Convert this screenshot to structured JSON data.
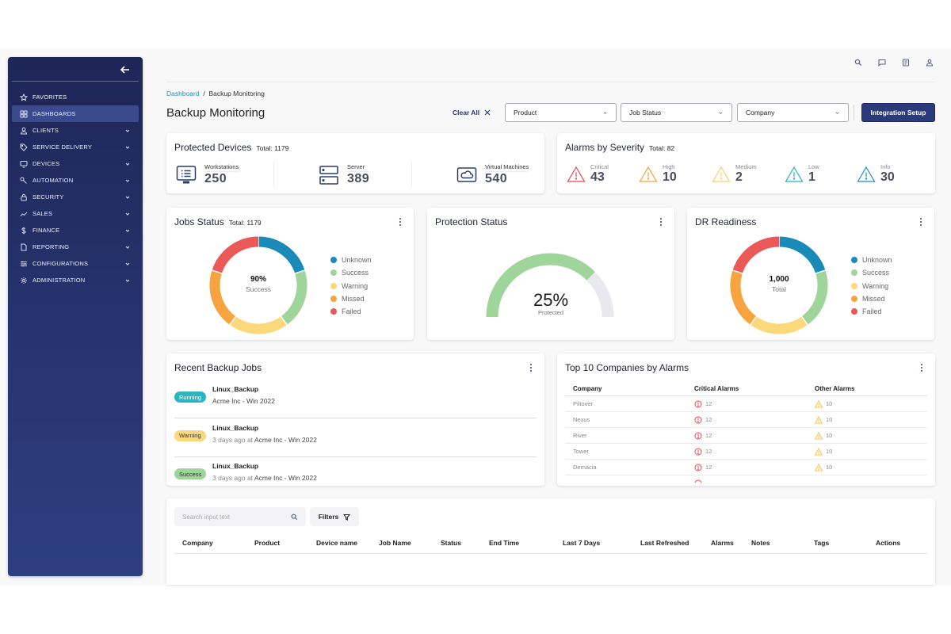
{
  "sidebar": {
    "items": [
      {
        "label": "FAVORITES",
        "icon": "star-icon",
        "chevron": false,
        "active": false
      },
      {
        "label": "DASHBOARDS",
        "icon": "dashboard-grid-icon",
        "chevron": false,
        "active": true
      },
      {
        "label": "CLIENTS",
        "icon": "user-icon",
        "chevron": true,
        "active": false
      },
      {
        "label": "SERVICE DELIVERY",
        "icon": "tag-icon",
        "chevron": true,
        "active": false
      },
      {
        "label": "DEVICES",
        "icon": "monitor-icon",
        "chevron": true,
        "active": false
      },
      {
        "label": "AUTOMATION",
        "icon": "wrench-icon",
        "chevron": true,
        "active": false
      },
      {
        "label": "SECURITY",
        "icon": "lock-icon",
        "chevron": true,
        "active": false
      },
      {
        "label": "SALES",
        "icon": "trend-icon",
        "chevron": true,
        "active": false
      },
      {
        "label": "FINANCE",
        "icon": "dollar-icon",
        "chevron": true,
        "active": false
      },
      {
        "label": "REPORTING",
        "icon": "document-icon",
        "chevron": true,
        "active": false
      },
      {
        "label": "CONFIGURATIONS",
        "icon": "sliders-icon",
        "chevron": true,
        "active": false
      },
      {
        "label": "ADMINISTRATION",
        "icon": "gear-icon",
        "chevron": true,
        "active": false
      }
    ]
  },
  "header": {
    "breadcrumb": {
      "root": "Dashboard",
      "separator": "/",
      "current": "Backup Monitoring"
    },
    "title": "Backup Monitoring",
    "clear_all": "Clear All",
    "filters": [
      {
        "label": "Product"
      },
      {
        "label": "Job Status"
      },
      {
        "label": "Company"
      }
    ],
    "primary_button": "Integration Setup",
    "top_icons": [
      "search-icon",
      "chat-icon",
      "notes-icon",
      "user-icon"
    ]
  },
  "protected_devices": {
    "title": "Protected Devices",
    "total_label": "Total: 1179",
    "items": [
      {
        "label": "Workstations",
        "value": "250",
        "icon": "workstation-icon"
      },
      {
        "label": "Server",
        "value": "389",
        "icon": "server-icon"
      },
      {
        "label": "Virtual Machines",
        "value": "540",
        "icon": "cloud-vm-icon"
      }
    ]
  },
  "alarms": {
    "title": "Alarms by Severity",
    "total_label": "Total: 82",
    "items": [
      {
        "label": "Critical",
        "value": "43",
        "color": "#e5484d"
      },
      {
        "label": "High",
        "value": "10",
        "color": "#f0a03a"
      },
      {
        "label": "Medium",
        "value": "2",
        "color": "#f5cf6a"
      },
      {
        "label": "Low",
        "value": "1",
        "color": "#24b3c0"
      },
      {
        "label": "Info",
        "value": "30",
        "color": "#1f8db5"
      }
    ]
  },
  "jobs_status": {
    "title": "Jobs Status",
    "total_label": "Total: 1179",
    "center_value": "90%",
    "center_label": "Success"
  },
  "protection_status": {
    "title": "Protection Status",
    "value_label": "25%",
    "sub_label": "Protected",
    "fill_fraction": 0.75,
    "fill_color": "#9fd59a",
    "track_color": "#e8e8ee"
  },
  "dr_readiness": {
    "title": "DR Readiness",
    "center_value": "1,000",
    "center_label": "Total"
  },
  "legend": [
    {
      "label": "Unknown",
      "color": "#1a8ab8"
    },
    {
      "label": "Success",
      "color": "#9fd59a"
    },
    {
      "label": "Warning",
      "color": "#fbd97a"
    },
    {
      "label": "Missed",
      "color": "#f7a440"
    },
    {
      "label": "Failed",
      "color": "#eb5858"
    }
  ],
  "chart_data": [
    {
      "type": "pie",
      "title": "Jobs Status",
      "categories": [
        "Unknown",
        "Success",
        "Warning",
        "Missed",
        "Failed"
      ],
      "values": [
        20,
        20,
        20,
        20,
        20
      ],
      "colors": [
        "#1a8ab8",
        "#9fd59a",
        "#fbd97a",
        "#f7a440",
        "#eb5858"
      ],
      "center_text": "90% Success",
      "legend": "right"
    },
    {
      "type": "pie",
      "title": "DR Readiness",
      "categories": [
        "Unknown",
        "Success",
        "Warning",
        "Missed",
        "Failed"
      ],
      "values": [
        20,
        20,
        20,
        20,
        20
      ],
      "colors": [
        "#1a8ab8",
        "#9fd59a",
        "#fbd97a",
        "#f7a440",
        "#eb5858"
      ],
      "center_text": "1,000 Total",
      "legend": "right"
    }
  ],
  "recent_jobs": {
    "title": "Recent Backup Jobs",
    "items": [
      {
        "status": "Running",
        "name": "Linux_Backup",
        "time": "",
        "target": "Acme Inc - Win 2022",
        "bg": "#2bb5bf",
        "fg": "#ffffff"
      },
      {
        "status": "Warning",
        "name": "Linux_Backup",
        "time": "3 days ago at",
        "target": "Acme Inc - Win 2022",
        "bg": "#fbd97a",
        "fg": "#333333"
      },
      {
        "status": "Success",
        "name": "Linux_Backup",
        "time": "3 days ago at",
        "target": "Acme Inc - Win 2022",
        "bg": "#9fd59a",
        "fg": "#333333"
      }
    ]
  },
  "top_companies": {
    "title": "Top 10 Companies by Alarms",
    "columns": [
      "Company",
      "Critical Alarms",
      "Other Alarms"
    ],
    "rows": [
      {
        "company": "Piltover",
        "critical": "12",
        "other": "10"
      },
      {
        "company": "Nexus",
        "critical": "12",
        "other": "10"
      },
      {
        "company": "River",
        "critical": "12",
        "other": "10"
      },
      {
        "company": "Tower",
        "critical": "12",
        "other": "10"
      },
      {
        "company": "Demacia",
        "critical": "12",
        "other": "10"
      }
    ]
  },
  "jobs_table": {
    "search_placeholder": "Search input text",
    "filters_label": "Filters",
    "columns": [
      "Company",
      "Product",
      "Device name",
      "Job Name",
      "Status",
      "End Time",
      "Last 7 Days",
      "Last Refreshed",
      "Alarms",
      "Notes",
      "Tags",
      "Actions"
    ]
  }
}
